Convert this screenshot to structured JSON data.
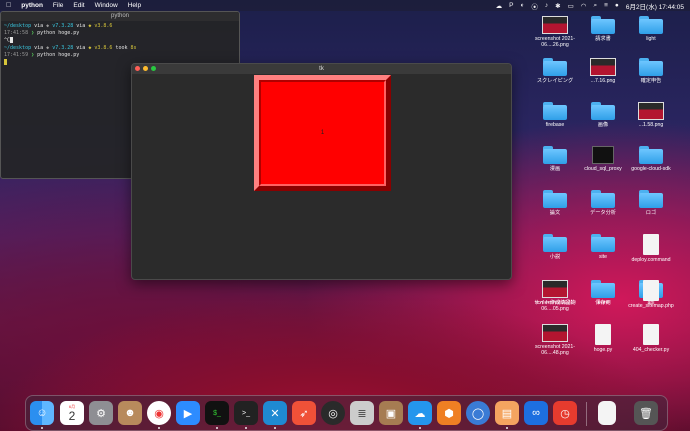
{
  "menubar": {
    "apple": "",
    "app_name": "python",
    "items": [
      "File",
      "Edit",
      "Window",
      "Help"
    ],
    "clock": "6月2日(水) 17:44:05"
  },
  "terminal": {
    "title": "python",
    "lines": [
      {
        "path": "~/desktop",
        "via1": "via",
        "ruby": "v7.3.28",
        "via2": "via",
        "py": "v3.8.6"
      },
      {
        "time": "17:41:58",
        "cmd": "python hoge.py"
      },
      {
        "text": "^C"
      },
      {
        "path": "~/desktop",
        "via1": "via",
        "ruby": "v7.3.28",
        "via2": "via",
        "py": "v3.8.6",
        "took": "took",
        "dur": "8s"
      },
      {
        "time": "17:41:59",
        "cmd": "python hoge.py"
      }
    ]
  },
  "tk": {
    "title": "tk",
    "button_label": "1",
    "accent": "#ff0000"
  },
  "desktop_icons": [
    {
      "label": "screenshot 2021-06....26.png",
      "kind": "thumb"
    },
    {
      "label": "請求書",
      "kind": "folder"
    },
    {
      "label": "light",
      "kind": "folder"
    },
    {
      "label": "スクレイピング",
      "kind": "folder"
    },
    {
      "label": "...7.16.png",
      "kind": "thumb"
    },
    {
      "label": "確定申告",
      "kind": "folder"
    },
    {
      "label": "firebase",
      "kind": "folder"
    },
    {
      "label": "画像",
      "kind": "folder"
    },
    {
      "label": "...1.58.png",
      "kind": "thumb"
    },
    {
      "label": "漫画",
      "kind": "folder"
    },
    {
      "label": "cloud_sql_proxy",
      "kind": "black"
    },
    {
      "label": "google-cloud-sdk",
      "kind": "folder"
    },
    {
      "label": "論文",
      "kind": "folder"
    },
    {
      "label": "データ分析",
      "kind": "folder"
    },
    {
      "label": "ロゴ",
      "kind": "folder"
    },
    {
      "label": "小説",
      "kind": "folder"
    },
    {
      "label": "site",
      "kind": "folder"
    },
    {
      "label": "deploy.command",
      "kind": "doc"
    },
    {
      "label": "サイト作成納品物",
      "kind": "folder"
    },
    {
      "label": "front",
      "kind": "folder"
    },
    {
      "label": "api",
      "kind": "folder"
    },
    {
      "label": "screenshot 2021-06....05.png",
      "kind": "thumb"
    },
    {
      "label": "保存用",
      "kind": "folder"
    },
    {
      "label": "create_sitemap.php",
      "kind": "doc"
    },
    {
      "label": "screenshot 2021-06....48.png",
      "kind": "thumb"
    },
    {
      "label": "hoge.py",
      "kind": "doc"
    },
    {
      "label": "404_checker.py",
      "kind": "doc"
    }
  ],
  "dock": {
    "calendar_month": "6月",
    "calendar_day": "2",
    "apps": [
      "Finder",
      "Calendar",
      "System Preferences",
      "Contacts",
      "Chrome",
      "Zoom",
      "iTerm",
      "Terminal",
      "VS Code",
      "Swift Playgrounds",
      "QuickTime",
      "Sequel",
      "Archive Utility",
      "Docker",
      "Sourcetree",
      "Simulator",
      "Preview",
      "Infinity",
      "Clock",
      "Document",
      "Trash"
    ]
  },
  "colors": {
    "folder": "#4cb1f0",
    "tk_button": "#ff0000",
    "terminal_bg": "#242426"
  }
}
